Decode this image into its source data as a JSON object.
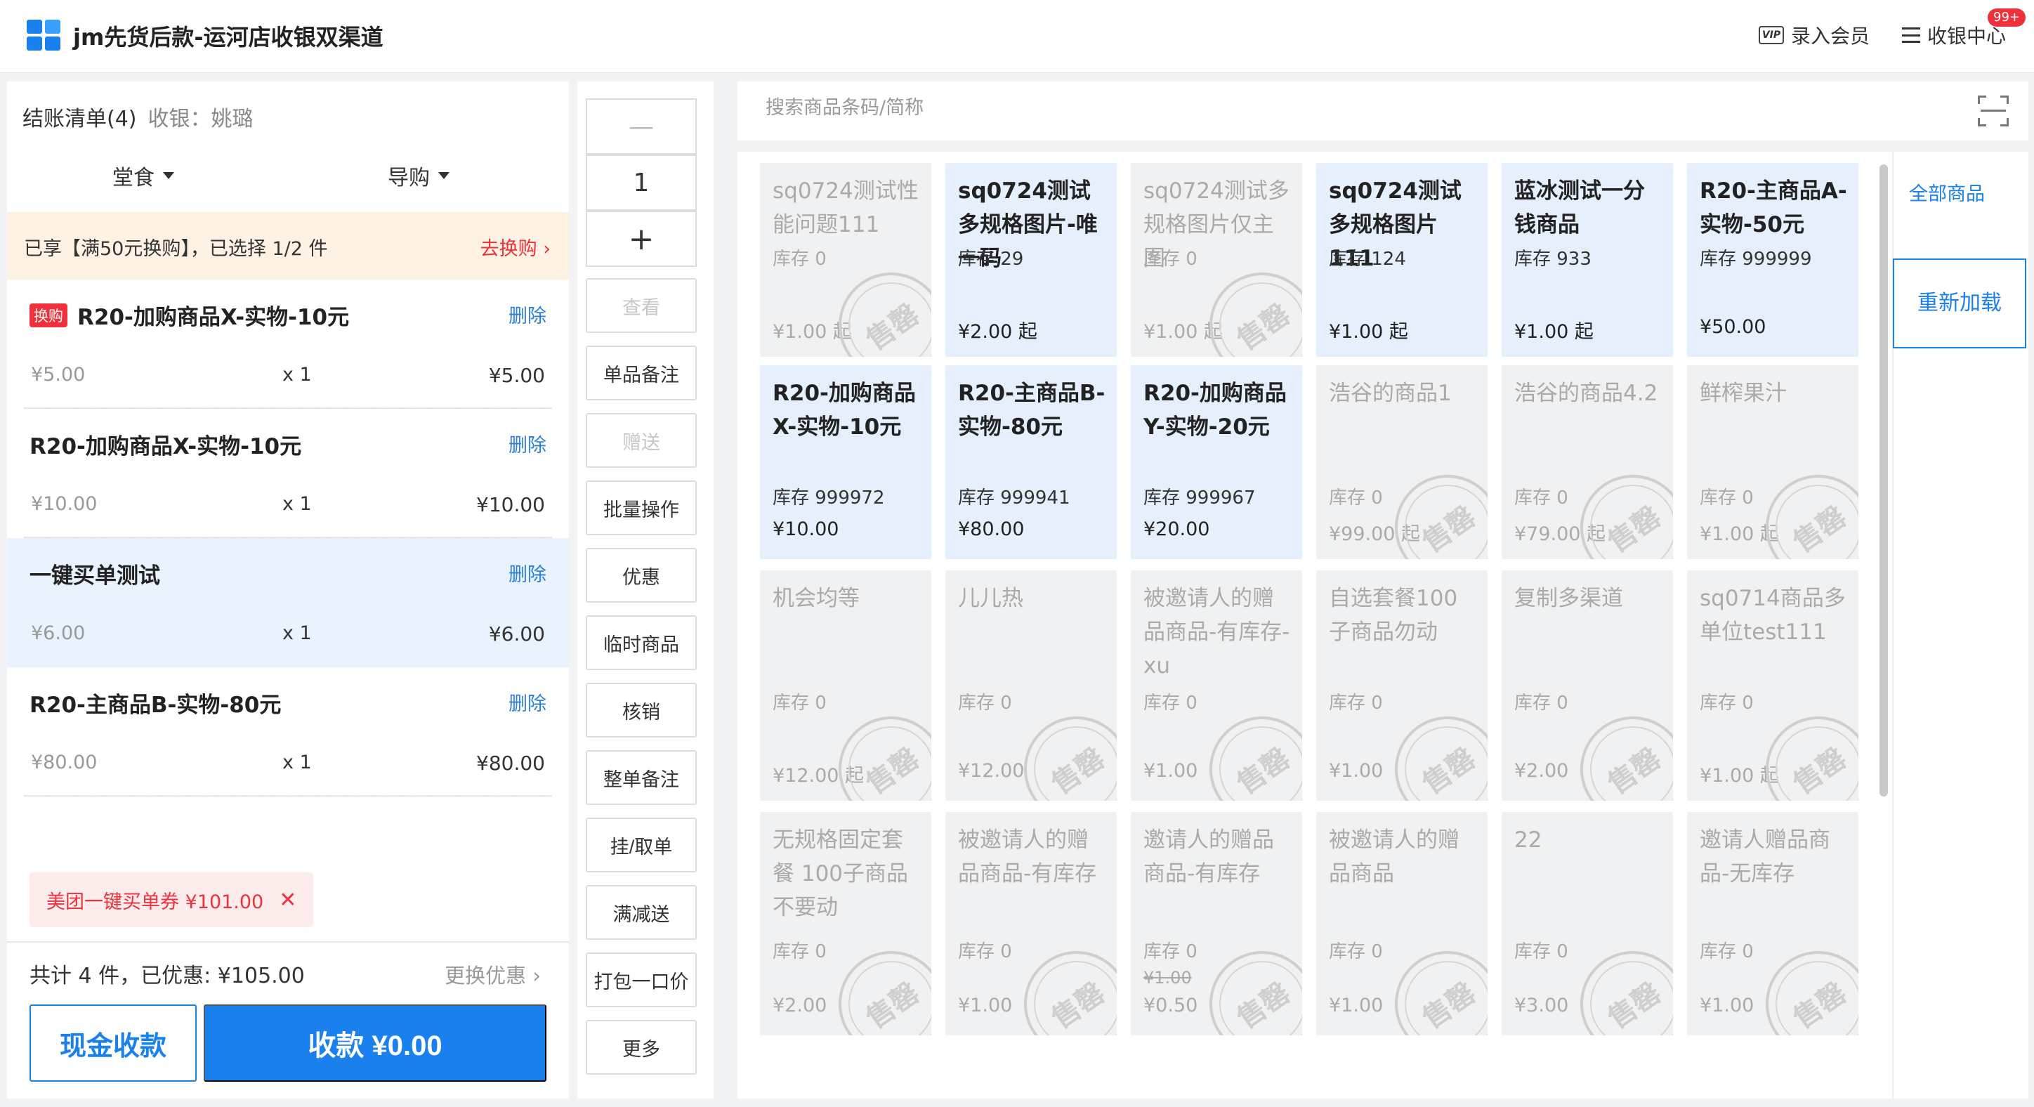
{
  "header": {
    "title": "jm先货后款-运河店收银双渠道",
    "member": "录入会员",
    "cashier_center": "收银中心",
    "badge": "99+"
  },
  "order": {
    "title": "结账清单(4)",
    "cashier": "收银：姚璐",
    "dine_label": "堂食",
    "guide_label": "导购",
    "promo_text": "已享【满50元换购】，已选择 1/2 件",
    "promo_link": "去换购 ›",
    "delete_label": "删除",
    "exchange_tag": "换购",
    "items": [
      {
        "name": "R20-加购商品X-实物-10元",
        "price": "¥5.00",
        "qty": "x 1",
        "subtotal": "¥5.00"
      },
      {
        "name": "R20-加购商品X-实物-10元",
        "price": "¥10.00",
        "qty": "x 1",
        "subtotal": "¥10.00"
      },
      {
        "name": "一键买单测试",
        "price": "¥6.00",
        "qty": "x 1",
        "subtotal": "¥6.00"
      },
      {
        "name": "R20-主商品B-实物-80元",
        "price": "¥80.00",
        "qty": "x 1",
        "subtotal": "¥80.00"
      }
    ],
    "coupon": "美团一键买单券 ¥101.00",
    "total": "共计 4 件，已优惠: ¥105.00",
    "change_promo": "更换优惠  ›",
    "cash_button": "现金收款",
    "pay_button": "收款 ¥0.00"
  },
  "toolbar": {
    "minus": "—",
    "quantity": "1",
    "plus": "+",
    "buttons": [
      "查看",
      "单品备注",
      "赠送",
      "批量操作",
      "优惠",
      "临时商品",
      "核销",
      "整单备注",
      "挂/取单",
      "满减送",
      "打包一口价",
      "更多"
    ]
  },
  "search": {
    "placeholder": "搜索商品条码/简称"
  },
  "categories": {
    "all": "全部商品",
    "reload": "重新加载"
  },
  "stamp_text": "售罄",
  "products": [
    {
      "name": "sq0724测试性能问题111",
      "stock": "库存 0",
      "price": "¥1.00 起",
      "avail": false
    },
    {
      "name": "sq0724测试多规格图片-唯一码",
      "stock": "库存 29",
      "price": "¥2.00 起",
      "avail": true
    },
    {
      "name": "sq0724测试多规格图片仅主图",
      "stock": "库存 0",
      "price": "¥1.00 起",
      "avail": false
    },
    {
      "name": "sq0724测试多规格图片111",
      "stock": "库存 124",
      "price": "¥1.00 起",
      "avail": true
    },
    {
      "name": "蓝冰测试一分钱商品",
      "stock": "库存 933",
      "price": "¥1.00 起",
      "avail": true
    },
    {
      "name": "R20-主商品A-实物-50元",
      "stock": "库存 999999",
      "price": "¥50.00",
      "avail": true
    },
    {
      "name": "R20-加购商品X-实物-10元",
      "stock": "库存 999972",
      "price": "¥10.00",
      "avail": true
    },
    {
      "name": "R20-主商品B-实物-80元",
      "stock": "库存 999941",
      "price": "¥80.00",
      "avail": true
    },
    {
      "name": "R20-加购商品Y-实物-20元",
      "stock": "库存 999967",
      "price": "¥20.00",
      "avail": true
    },
    {
      "name": "浩谷的商品1",
      "stock": "库存 0",
      "price": "¥99.00 起",
      "avail": false
    },
    {
      "name": "浩谷的商品4.2",
      "stock": "库存 0",
      "price": "¥79.00 起",
      "avail": false
    },
    {
      "name": "鲜榨果汁",
      "stock": "库存 0",
      "price": "¥1.00 起",
      "avail": false
    },
    {
      "name": "机会均等",
      "stock": "库存 0",
      "price": "¥12.00 起",
      "avail": false
    },
    {
      "name": "儿儿热",
      "stock": "库存 0",
      "price": "¥12.00",
      "avail": false
    },
    {
      "name": "被邀请人的赠品商品-有库存-xu",
      "stock": "库存 0",
      "price": "¥1.00",
      "avail": false
    },
    {
      "name": "自选套餐100子商品勿动",
      "stock": "库存 0",
      "price": "¥1.00",
      "avail": false
    },
    {
      "name": "复制多渠道",
      "stock": "库存 0",
      "price": "¥2.00",
      "avail": false
    },
    {
      "name": "sq0714商品多单位test111",
      "stock": "库存 0",
      "price": "¥1.00 起",
      "avail": false
    },
    {
      "name": "无规格固定套餐 100子商品不要动",
      "stock": "库存 0",
      "price": "¥2.00",
      "avail": false
    },
    {
      "name": "被邀请人的赠品商品-有库存",
      "stock": "库存 0",
      "price": "¥1.00",
      "avail": false
    },
    {
      "name": "邀请人的赠品商品-有库存",
      "stock": "库存 0",
      "old_price": "¥1.00",
      "price": "¥0.50",
      "avail": false
    },
    {
      "name": "被邀请人的赠品商品",
      "stock": "库存 0",
      "price": "¥1.00",
      "avail": false
    },
    {
      "name": "22",
      "stock": "库存 0",
      "price": "¥3.00",
      "avail": false
    },
    {
      "name": "邀请人赠品商品-无库存",
      "stock": "库存 0",
      "price": "¥1.00",
      "avail": false
    }
  ]
}
